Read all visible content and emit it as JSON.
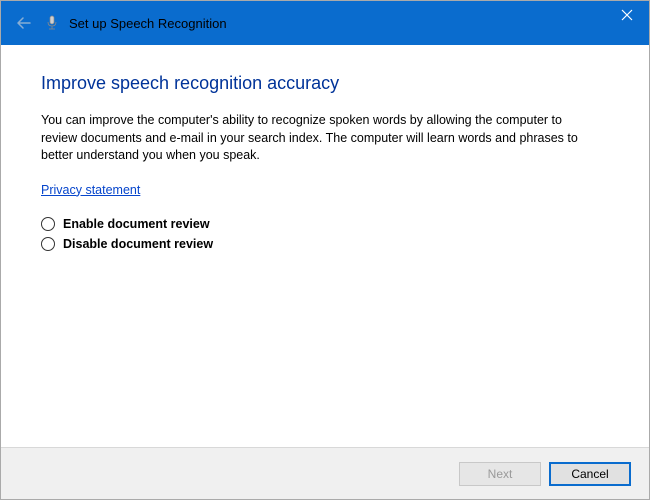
{
  "titlebar": {
    "title": "Set up Speech Recognition"
  },
  "content": {
    "heading": "Improve speech recognition accuracy",
    "body": "You can improve the computer's ability to recognize spoken words by allowing the computer to review documents and e-mail in your search index. The computer will learn words and phrases to better understand you when you speak.",
    "privacy_link": "Privacy statement",
    "radio_enable": "Enable document review",
    "radio_disable": "Disable document review"
  },
  "footer": {
    "next": "Next",
    "cancel": "Cancel"
  }
}
